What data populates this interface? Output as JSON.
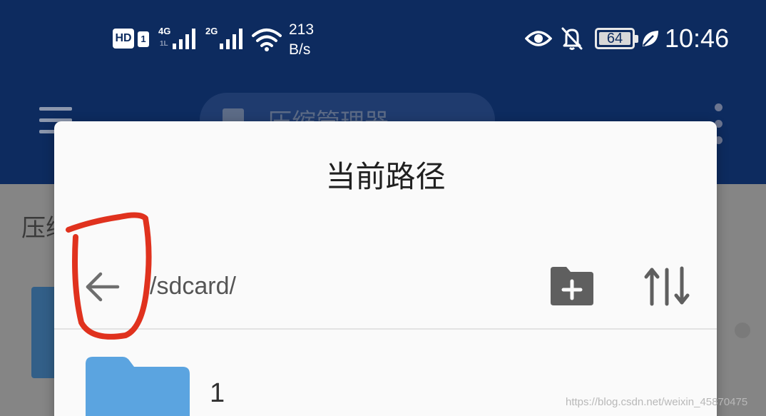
{
  "status_bar": {
    "hd_label": "HD",
    "hd_sim": "1",
    "network_1": "4G",
    "network_1_sub": "1L",
    "network_2": "2G",
    "net_speed_value": "213",
    "net_speed_unit": "B/s",
    "battery_level": "64",
    "time": "10:46",
    "icons": [
      "hd-volte-icon",
      "signal-4g-icon",
      "signal-2g-icon",
      "wifi-icon",
      "eye-icon",
      "bell-off-icon",
      "battery-icon",
      "eco-leaf-icon"
    ]
  },
  "app_bar": {
    "title": "压缩管理器",
    "menu_icon": "menu-icon",
    "more_icon": "more-vert-icon"
  },
  "background": {
    "label": "压缩"
  },
  "dialog": {
    "title": "当前路径",
    "path": "/sdcard/",
    "back_icon": "arrow-left-icon",
    "new_folder_icon": "create-folder-icon",
    "sort_icon": "sort-icon",
    "items": [
      {
        "name": "1",
        "icon": "folder-icon"
      }
    ]
  },
  "watermark": "https://blog.csdn.net/weixin_45870475",
  "colors": {
    "app_bar": "#0d2b5f",
    "dialog_bg": "#fafafa",
    "folder": "#5ba4e0",
    "annotation": "#e0321e"
  }
}
